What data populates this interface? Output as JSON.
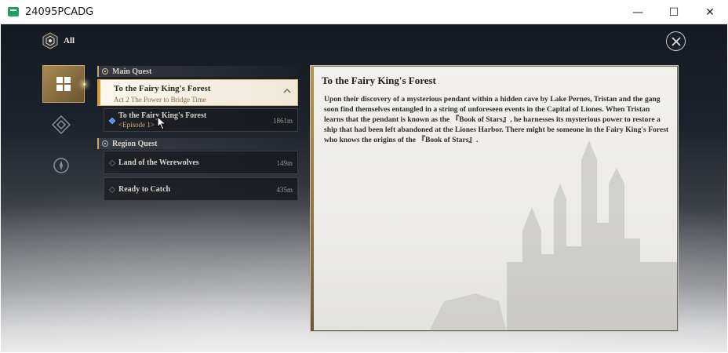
{
  "window": {
    "title": "24095PCADG",
    "minimize": "—",
    "maximize": "☐",
    "close": "✕"
  },
  "filter": {
    "label": "All"
  },
  "sections": {
    "main": "Main Quest",
    "region": "Region Quest"
  },
  "quests": {
    "selected": {
      "title": "To the Fairy King's Forest",
      "subtitle": "Act 2   The Power to Bridge Time"
    },
    "episode": {
      "title": "To the Fairy King's Forest",
      "subtitle": "<Episode 1>",
      "distance": "1861m"
    },
    "werewolves": {
      "title": "Land of the Werewolves",
      "distance": "149m"
    },
    "ready": {
      "title": "Ready to Catch",
      "distance": "435m"
    }
  },
  "detail": {
    "title": "To the Fairy King's Forest",
    "body": "Upon their discovery of a mysterious pendant within a hidden cave by Lake Pernes, Tristan and the gang soon find themselves entangled in a string of unforeseen events in the Capital of Liones. When Tristan learns that the pendant is known as the 『Book of Stars』, he harnesses its mysterious power to restore a ship that had been left abandoned at the Liones Harbor. There might be someone in the Fairy King's Forest who knows the origins of the 『Book of Stars』."
  },
  "icons": {
    "app": "app-icon",
    "filter": "filter-emblem-icon",
    "close": "close-icon",
    "rail_active": "all-quests-icon",
    "rail_2": "diamond-quest-icon",
    "rail_3": "compass-quest-icon",
    "chevron": "chevron-up-icon",
    "tracking": "tracking-diamond-icon"
  },
  "colors": {
    "accent_gold": "#c8a766",
    "selected_bar": "#d99a3a",
    "tracking_blue": "#3f8ee8"
  }
}
